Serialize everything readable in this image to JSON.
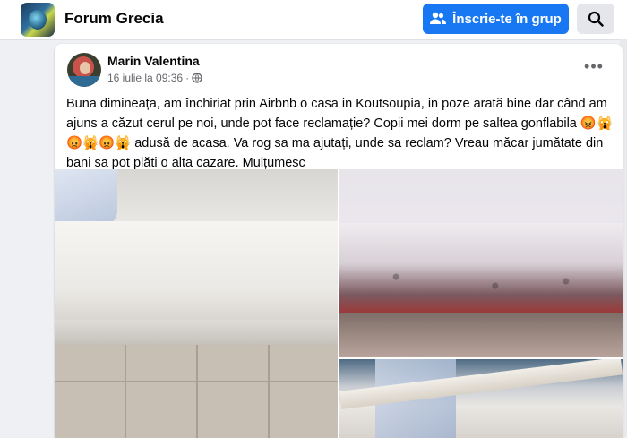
{
  "header": {
    "group_name": "Forum Grecia",
    "join_label": "Înscrie-te în grup",
    "icons": {
      "join": "people-plus-icon",
      "search": "search-icon"
    }
  },
  "post": {
    "author": "Marin Valentina",
    "timestamp": "16 iulie la 09:36",
    "separator": "·",
    "privacy_icon": "globe-icon",
    "more_icon": "more-horizontal-icon",
    "text": "Buna dimineața, am închiriat prin Airbnb o casa in Koutsoupia, in poze arată bine dar când am ajuns a căzut cerul pe noi, unde pot face reclamație? Copii mei dorm pe saltea gonflabila 😡🙀😡🙀😡🙀 adusă de acasa. Va rog sa ma ajutați, unde sa reclam? Vreau măcar jumătate din bani sa pot plăti o alta cazare. Mulțumesc",
    "photos": [
      "mattress-photo",
      "moldy-mattress-photo",
      "bed-frame-photo"
    ]
  },
  "colors": {
    "accent": "#1877f2",
    "background": "#eef0f4",
    "secondary_text": "#65676b"
  }
}
